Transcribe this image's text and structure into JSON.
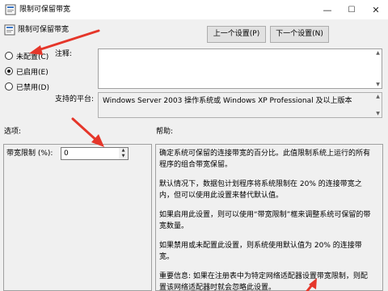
{
  "window": {
    "title": "限制可保留带宽",
    "minimize_glyph": "—",
    "maximize_glyph": "☐",
    "close_glyph": "✕"
  },
  "header": {
    "policy_name": "限制可保留带宽",
    "prev_label": "上一个设置(P)",
    "next_label": "下一个设置(N)"
  },
  "state_options": [
    {
      "label": "未配置(C)",
      "checked": false
    },
    {
      "label": "已启用(E)",
      "checked": true
    },
    {
      "label": "已禁用(D)",
      "checked": false
    }
  ],
  "comment": {
    "label": "注释:",
    "value": ""
  },
  "platform": {
    "label": "支持的平台:",
    "value": "Windows Server 2003 操作系统或 Windows XP Professional 及以上版本"
  },
  "options": {
    "section_label": "选项:",
    "bandwidth_label": "带宽限制 (%):",
    "bandwidth_value": "0"
  },
  "help": {
    "section_label": "帮助:",
    "paragraphs": [
      "确定系统可保留的连接带宽的百分比。此值限制系统上运行的所有程序的组合带宽保留。",
      "默认情况下，数据包计划程序将系统限制在 20% 的连接带宽之内，但可以使用此设置来替代默认值。",
      "如果启用此设置，则可以使用“带宽限制”框来调整系统可保留的带宽数量。",
      "如果禁用或未配置此设置，则系统使用默认值为 20% 的连接带宽。",
      "重要信息: 如果在注册表中为特定网络适配器设置带宽限制，则配置该网络适配器时就会忽略此设置。"
    ]
  },
  "annotation_color": "#e5362a"
}
